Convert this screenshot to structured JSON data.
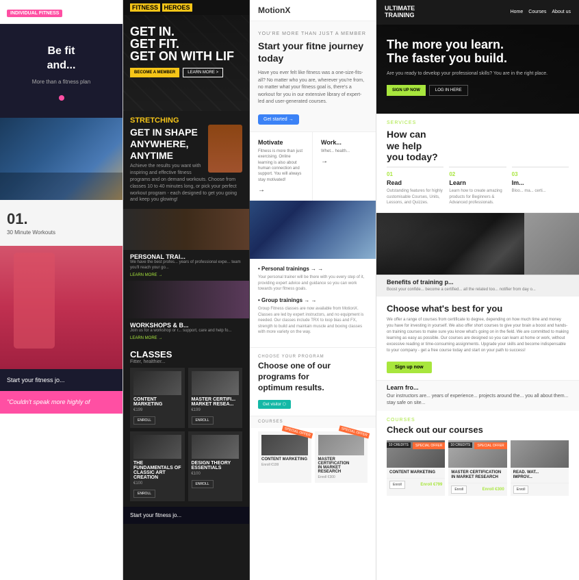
{
  "col1": {
    "badge": "INDIVIDUAL FITNESS",
    "hero_title": "Be fit\nand...",
    "hero_sub": "More than a fitness plan",
    "num": "01.",
    "num_label": "30 Minute Workouts",
    "bottom_text": "Start your fitness jo...",
    "quote": "\"Couldn't speak more highly of"
  },
  "col2": {
    "logo_text": "FITNESS",
    "logo_highlight": "HEROES",
    "hero_title": "GET IN.\nGET FIT.\nGET ON WITH LIF",
    "btn_become": "BECOME A MEMBER",
    "btn_learn": "LEARN MORE >",
    "section_title": "STRETCHING",
    "section_subtitle": "GET IN SHAPE\nANYWHERE,\nANYTIME",
    "section_text": "Achieve the results you want with inspiring and effective fitness programs and on demand workouts. Choose from classes 10 to 40 minutes long, or pick your perfect workout program - each designed to get you going and keep you glowing!",
    "trainer_title": "PERSONAL TRAI...",
    "trainer_text": "We have the best profes... years of professional expe... team you'll reach your go...",
    "learn_more": "LEARN MORE →",
    "workshop_title": "WORKSHOPS & B...",
    "workshop_text": "Join us for a workshop or r... support, care and help fo...",
    "classes_title": "CLASSES",
    "classes_sub": "Fitter, healthier...",
    "class1_title": "CONTENT MARKETING",
    "class1_price": "€199",
    "class2_title": "MASTER CERTIFI...\nMARKET RESEA...",
    "class2_price": "€199",
    "class3_title": "THE FUNDAMENTALS OF\nCLASSIC ART CREATION",
    "class3_price": "€100",
    "class4_title": "DESIGN THEORY\nESSENTIALS",
    "class4_price": "€100",
    "enroll": "ENROLL",
    "bottom_text": "Start your fitness jo..."
  },
  "col3": {
    "logo": "MotionX",
    "hero_label": "YOU'RE MORE THAN JUST A MEMBER",
    "hero_title": "Start your fitne\njourney today",
    "hero_p": "Have you ever felt like fitness was a one-size-fits-all? No matter who you are, wherever you're from, no matter what your fitness goal is, there's a workout for you in our extensive library of expert-led and user-generated courses.",
    "btn_started": "Get started →",
    "motivate_title": "Motivate",
    "motivate_text": "Fitness is more than just exercising. Online learning is also about human connection and support. You will always stay motivated!",
    "work_title": "Work...",
    "work_text": "Whet... health...",
    "arrow": "→",
    "city_img_alt": "city skyline image",
    "personal_trainings": "• Personal trainings →",
    "personal_text": "Your personal trainer will be there with you every step of it, providing expert advice and guidance so you can work towards your fitness goals.",
    "group_trainings": "• Group trainings →",
    "group_text": "Group Fitness classes are now available from MotionX. Classes are led by expert instructors, and no equipment is needed. Our classes include TRX to loop bias and FX, strength to build and maintain muscle and boxing classes with more variety on the way.",
    "program_label": "CHOOSE YOUR PROGRAM",
    "program_title": "Choose one of our\nprograms for\noptimum results.",
    "btn_visitor": "Get visitor ⬡",
    "courses_label": "COURSES",
    "course1_title": "Content Marketing",
    "course2_title": "Master Certification\nin Market Research",
    "course1_price": "Enroll €199",
    "course2_price": "Enroll €300",
    "badge": "SPECIAL OFFER"
  },
  "col4": {
    "logo_line1": "ULTIMATE",
    "logo_line2": "TRAINING",
    "nav": [
      "Home",
      "Courses",
      "About us"
    ],
    "hero_title": "The more you learn.\nThe faster you build.",
    "hero_sub": "Are you ready to develop your professional skills? You are in the right place.",
    "btn_signup": "SIGN UP NOW",
    "btn_login": "LOG IN HERE",
    "services_label": "SERVICES",
    "services_title": "How can\nwe help\nyou today?",
    "service_num1": "01",
    "service_title1": "Read",
    "service_text1": "Outstanding features for highly customisable Courses, Units, Lessons, and Quizzes.",
    "service_num2": "02",
    "service_title2": "Learn",
    "service_text2": "Learn how to create amazing products for Beginners & Advanced professionals.",
    "service_num3": "03",
    "service_title3": "Im...",
    "service_text3": "Bloo... ma... certi...",
    "choose_title": "Choose what's best for you",
    "choose_text": "We offer a range of courses from certificate to degree, depending on how much time and money you have for investing in yourself. We also offer short courses to give your brain a boost and hands-on training courses to make sure you know what's going on in the field. We are committed to making learning as easy as possible. Our courses are designed so you can learn at home or work, without excessive reading or time-consuming assignments. Upgrade your skills and become indispensable to your company - get a free course today and start on your path to success!",
    "btn_signup2": "Sign up now",
    "learn_title": "Learn fro...",
    "learn_text": "Our instructors are... years of experience... projects around the... you all about them... stay safe on site...",
    "benefits_title": "Benefits of\ntraining p...",
    "benefits_text": "Boost your confide... become a certified... all the related too... notifier from day o...",
    "courses_label": "COURSES",
    "courses_title": "Check out our courses",
    "course1_title": "Content Marketing",
    "course2_title": "Master Certification\nin Market Research",
    "course3_title": "Read. Wat...\nImprov...",
    "course1_credits": "10 CREDITS",
    "course2_credits": "10 CREDITS",
    "course1_price": "Enroll €799",
    "course2_price": "Enroll €300",
    "badge": "SPECIAL OFFER"
  }
}
